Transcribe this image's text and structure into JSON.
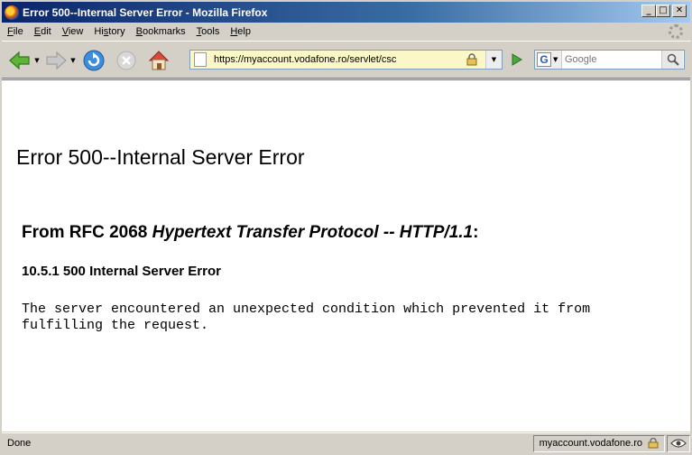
{
  "window": {
    "title": "Error 500--Internal Server Error - Mozilla Firefox",
    "minimize_glyph": "_",
    "maximize_glyph": "□",
    "close_glyph": "✕"
  },
  "menu": [
    {
      "accel": "F",
      "rest": "ile"
    },
    {
      "accel": "E",
      "rest": "dit"
    },
    {
      "accel": "V",
      "rest": "iew"
    },
    {
      "accel": "",
      "pre": "Hi",
      "accel2": "s",
      "rest": "tory"
    },
    {
      "accel": "B",
      "rest": "ookmarks"
    },
    {
      "accel": "T",
      "rest": "ools"
    },
    {
      "accel": "H",
      "rest": "elp"
    }
  ],
  "navigation": {
    "url": "https://myaccount.vodafone.ro/servlet/csc",
    "search_placeholder": "Google",
    "search_engine_letter": "G"
  },
  "content": {
    "heading": "Error 500--Internal Server Error",
    "rfc_prefix": "From RFC 2068 ",
    "rfc_title": "Hypertext Transfer Protocol -- HTTP/1.1",
    "rfc_suffix": ":",
    "section": "10.5.1 500 Internal Server Error",
    "message": "The server encountered an unexpected condition which prevented it from\nfulfilling the request."
  },
  "status": {
    "text": "Done",
    "host": "myaccount.vodafone.ro"
  },
  "icons": [
    "firefox-icon",
    "back-icon",
    "forward-icon",
    "reload-icon",
    "stop-icon",
    "home-icon",
    "page-icon",
    "lock-icon",
    "go-icon",
    "search-icon",
    "eye-icon",
    "throbber-icon"
  ],
  "colors": {
    "titlebar_start": "#0a246a",
    "titlebar_end": "#a6caf0",
    "url_background": "#fbf7c7"
  }
}
